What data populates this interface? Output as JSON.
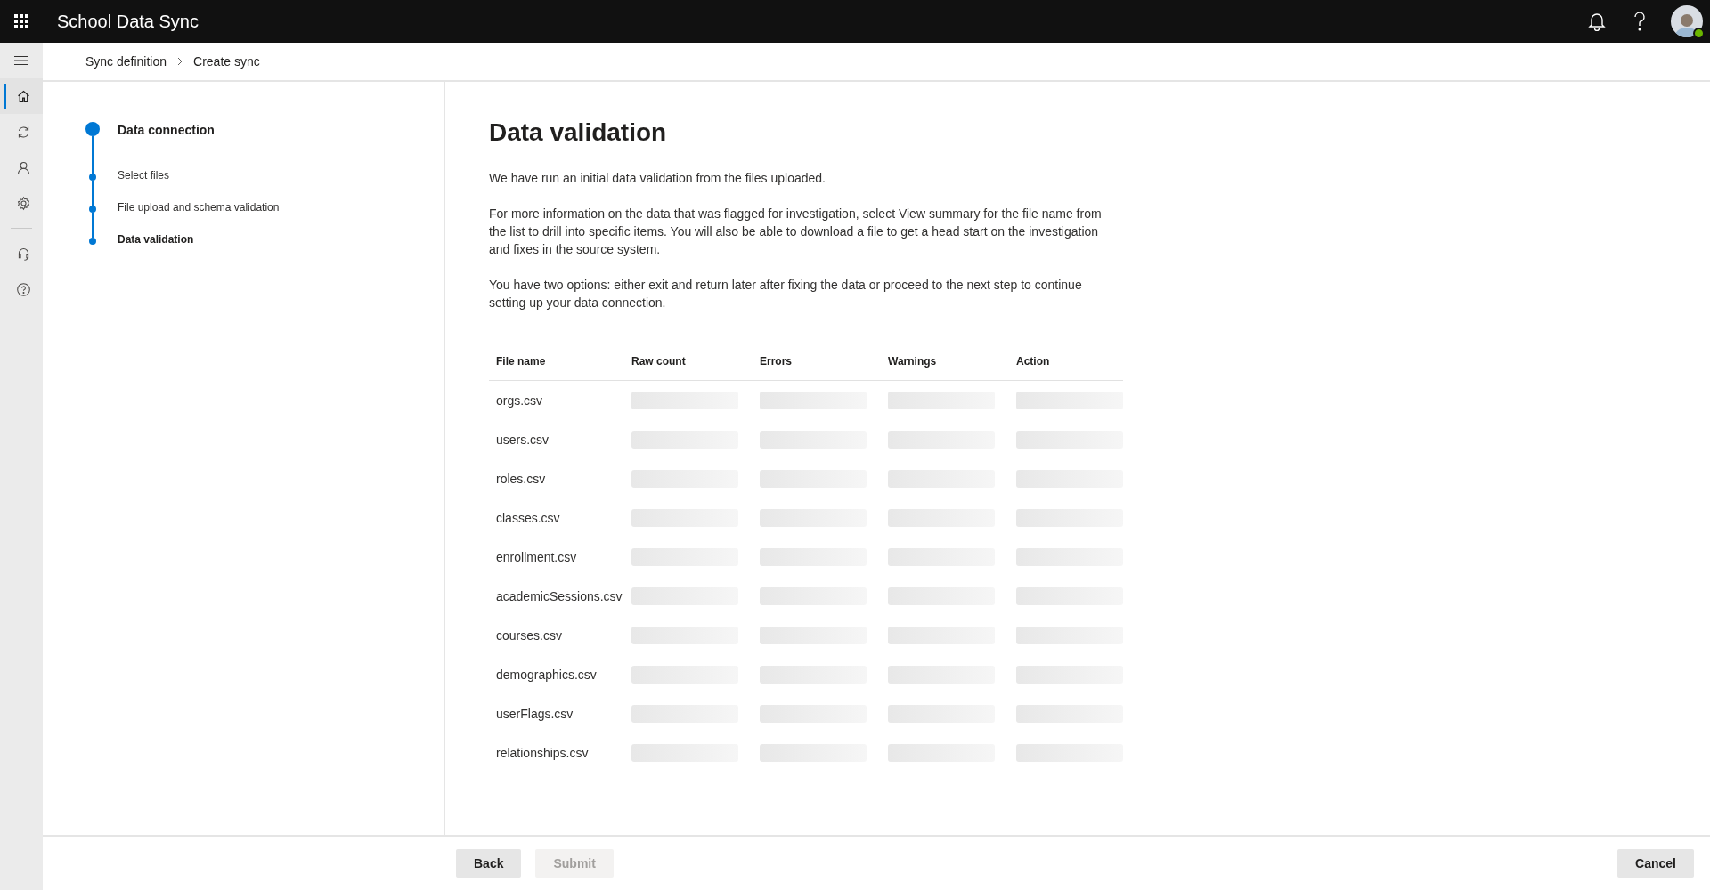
{
  "app_bar": {
    "title": "School Data Sync"
  },
  "nav_rail": [
    {
      "kind": "home",
      "selected": true
    },
    {
      "kind": "sync",
      "selected": false
    },
    {
      "kind": "person",
      "selected": false
    },
    {
      "kind": "gear",
      "selected": false
    },
    {
      "kind": "divider"
    },
    {
      "kind": "headset",
      "selected": false
    },
    {
      "kind": "help",
      "selected": false
    }
  ],
  "breadcrumb": [
    "Sync definition",
    "Create sync"
  ],
  "steps": [
    {
      "label": "Data connection",
      "kind": "main"
    },
    {
      "label": "Select files",
      "kind": "sub"
    },
    {
      "label": "File upload and schema validation",
      "kind": "sub"
    },
    {
      "label": "Data validation",
      "kind": "sub",
      "selected": true
    }
  ],
  "heading": "Data validation",
  "paragraphs": [
    "We have run an initial data validation from the files uploaded.",
    "For more information on the data that was flagged for investigation, select View summary for the file name from the list to drill into specific items. You will also be able to download a file to get a head start on the investigation and fixes in the source system.",
    "You have two options: either exit and return later after fixing the data or proceed to the next step to continue setting up your data connection."
  ],
  "table": {
    "columns": [
      "File name",
      "Raw count",
      "Errors",
      "Warnings",
      "Action"
    ],
    "rows": [
      "orgs.csv",
      "users.csv",
      "roles.csv",
      "classes.csv",
      "enrollment.csv",
      "academicSessions.csv",
      "courses.csv",
      "demographics.csv",
      "userFlags.csv",
      "relationships.csv"
    ]
  },
  "footer": {
    "buttons": [
      {
        "label": "Back",
        "disabled": false
      },
      {
        "label": "Submit",
        "disabled": true
      }
    ],
    "cancel": "Cancel"
  }
}
